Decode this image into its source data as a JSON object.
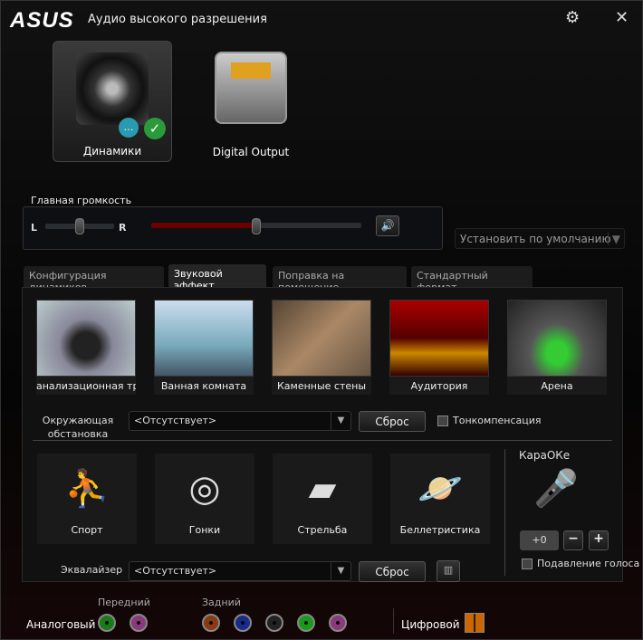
{
  "app": {
    "logo": "ASUS",
    "title": "Аудио высокого разрешения",
    "settings": "⚙",
    "close": "✕"
  },
  "devices": [
    {
      "label": "Динамики",
      "selected": true
    },
    {
      "label": "Digital Output",
      "selected": false
    }
  ],
  "volume": {
    "label": "Главная громкость",
    "left": "L",
    "right": "R",
    "balance": 0.5,
    "level": 0.5,
    "mute_icon": "🔊"
  },
  "default_button": "Установить по умолчанию",
  "tabs": [
    "Конфигурация динамиков",
    "Звуковой эффект",
    "Поправка на помещение",
    "Стандартный формат"
  ],
  "environments": [
    "анализационная труб",
    "Ванная комната",
    "Каменные стены",
    "Аудитория",
    "Арена"
  ],
  "environment": {
    "label1": "Окружающая",
    "label2": "обстановка",
    "value": "<Отсутствует>",
    "reset": "Сброс",
    "loudness": "Тонкомпенсация"
  },
  "effects": [
    {
      "label": "Спорт",
      "icon": "⛹"
    },
    {
      "label": "Гонки",
      "icon": "◎"
    },
    {
      "label": "Стрельба",
      "icon": "▰"
    },
    {
      "label": "Беллетристика",
      "icon": "🪐"
    }
  ],
  "karaoke": {
    "title": "КараОКе",
    "value": "+0",
    "minus": "−",
    "plus": "+",
    "voice_cancel": "Подавление голоса"
  },
  "equalizer": {
    "label": "Эквалайзер",
    "value": "<Отсутствует>",
    "reset": "Сброс"
  },
  "footer": {
    "analog": "Аналоговый",
    "front": "Передний",
    "rear": "Задний",
    "digital": "Цифровой"
  },
  "jack_colors": {
    "front": [
      "#1a7a1a",
      "#8a3a7a"
    ],
    "rear": [
      "#8a3a10",
      "#1a2a8a",
      "#222222",
      "#1a9a1a",
      "#8a3a7a"
    ]
  }
}
